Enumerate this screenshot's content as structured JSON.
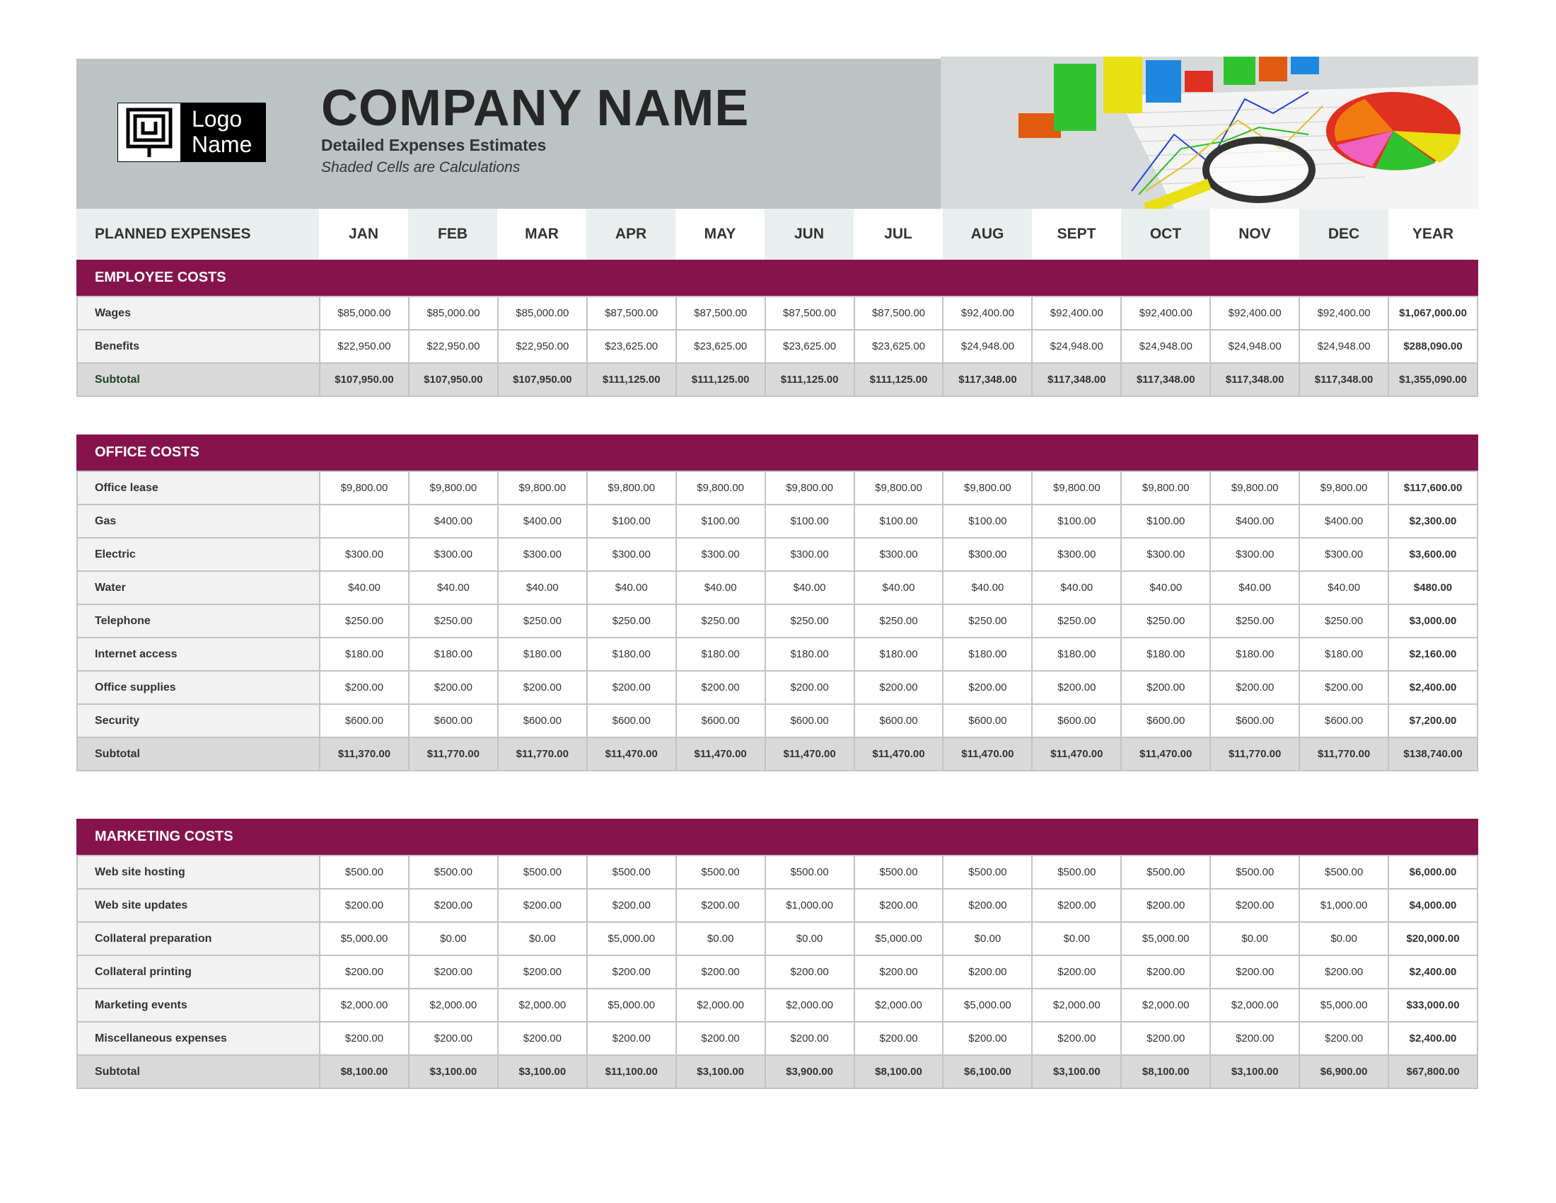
{
  "header": {
    "logo_text": "Logo Name",
    "company_name": "COMPANY NAME",
    "subtitle": "Detailed Expenses Estimates",
    "note": "Shaded Cells are Calculations"
  },
  "columns": {
    "label": "PLANNED EXPENSES",
    "months": [
      "JAN",
      "FEB",
      "MAR",
      "APR",
      "MAY",
      "JUN",
      "JUL",
      "AUG",
      "SEPT",
      "OCT",
      "NOV",
      "DEC",
      "YEAR"
    ]
  },
  "colors": {
    "section_header": "#87134d",
    "banner": "#bcc3c4",
    "subtotal": "#d9d9d9"
  },
  "sections": [
    {
      "title": "EMPLOYEE COSTS",
      "rows": [
        {
          "label": "Wages",
          "values": [
            "$85,000.00",
            "$85,000.00",
            "$85,000.00",
            "$87,500.00",
            "$87,500.00",
            "$87,500.00",
            "$87,500.00",
            "$92,400.00",
            "$92,400.00",
            "$92,400.00",
            "$92,400.00",
            "$92,400.00",
            "$1,067,000.00"
          ]
        },
        {
          "label": "Benefits",
          "values": [
            "$22,950.00",
            "$22,950.00",
            "$22,950.00",
            "$23,625.00",
            "$23,625.00",
            "$23,625.00",
            "$23,625.00",
            "$24,948.00",
            "$24,948.00",
            "$24,948.00",
            "$24,948.00",
            "$24,948.00",
            "$288,090.00"
          ]
        }
      ],
      "subtotal": {
        "label": "Subtotal",
        "values": [
          "$107,950.00",
          "$107,950.00",
          "$107,950.00",
          "$111,125.00",
          "$111,125.00",
          "$111,125.00",
          "$111,125.00",
          "$117,348.00",
          "$117,348.00",
          "$117,348.00",
          "$117,348.00",
          "$117,348.00",
          "$1,355,090.00"
        ]
      }
    },
    {
      "title": "OFFICE COSTS",
      "rows": [
        {
          "label": "Office lease",
          "values": [
            "$9,800.00",
            "$9,800.00",
            "$9,800.00",
            "$9,800.00",
            "$9,800.00",
            "$9,800.00",
            "$9,800.00",
            "$9,800.00",
            "$9,800.00",
            "$9,800.00",
            "$9,800.00",
            "$9,800.00",
            "$117,600.00"
          ]
        },
        {
          "label": "Gas",
          "values": [
            "",
            "$400.00",
            "$400.00",
            "$100.00",
            "$100.00",
            "$100.00",
            "$100.00",
            "$100.00",
            "$100.00",
            "$100.00",
            "$400.00",
            "$400.00",
            "$2,300.00"
          ]
        },
        {
          "label": "Electric",
          "values": [
            "$300.00",
            "$300.00",
            "$300.00",
            "$300.00",
            "$300.00",
            "$300.00",
            "$300.00",
            "$300.00",
            "$300.00",
            "$300.00",
            "$300.00",
            "$300.00",
            "$3,600.00"
          ]
        },
        {
          "label": "Water",
          "values": [
            "$40.00",
            "$40.00",
            "$40.00",
            "$40.00",
            "$40.00",
            "$40.00",
            "$40.00",
            "$40.00",
            "$40.00",
            "$40.00",
            "$40.00",
            "$40.00",
            "$480.00"
          ]
        },
        {
          "label": "Telephone",
          "values": [
            "$250.00",
            "$250.00",
            "$250.00",
            "$250.00",
            "$250.00",
            "$250.00",
            "$250.00",
            "$250.00",
            "$250.00",
            "$250.00",
            "$250.00",
            "$250.00",
            "$3,000.00"
          ]
        },
        {
          "label": "Internet access",
          "values": [
            "$180.00",
            "$180.00",
            "$180.00",
            "$180.00",
            "$180.00",
            "$180.00",
            "$180.00",
            "$180.00",
            "$180.00",
            "$180.00",
            "$180.00",
            "$180.00",
            "$2,160.00"
          ]
        },
        {
          "label": "Office supplies",
          "values": [
            "$200.00",
            "$200.00",
            "$200.00",
            "$200.00",
            "$200.00",
            "$200.00",
            "$200.00",
            "$200.00",
            "$200.00",
            "$200.00",
            "$200.00",
            "$200.00",
            "$2,400.00"
          ]
        },
        {
          "label": "Security",
          "values": [
            "$600.00",
            "$600.00",
            "$600.00",
            "$600.00",
            "$600.00",
            "$600.00",
            "$600.00",
            "$600.00",
            "$600.00",
            "$600.00",
            "$600.00",
            "$600.00",
            "$7,200.00"
          ]
        }
      ],
      "subtotal": {
        "label": "Subtotal",
        "values": [
          "$11,370.00",
          "$11,770.00",
          "$11,770.00",
          "$11,470.00",
          "$11,470.00",
          "$11,470.00",
          "$11,470.00",
          "$11,470.00",
          "$11,470.00",
          "$11,470.00",
          "$11,770.00",
          "$11,770.00",
          "$138,740.00"
        ]
      }
    },
    {
      "title": "MARKETING COSTS",
      "rows": [
        {
          "label": "Web site hosting",
          "values": [
            "$500.00",
            "$500.00",
            "$500.00",
            "$500.00",
            "$500.00",
            "$500.00",
            "$500.00",
            "$500.00",
            "$500.00",
            "$500.00",
            "$500.00",
            "$500.00",
            "$6,000.00"
          ]
        },
        {
          "label": "Web site updates",
          "values": [
            "$200.00",
            "$200.00",
            "$200.00",
            "$200.00",
            "$200.00",
            "$1,000.00",
            "$200.00",
            "$200.00",
            "$200.00",
            "$200.00",
            "$200.00",
            "$1,000.00",
            "$4,000.00"
          ]
        },
        {
          "label": "Collateral preparation",
          "values": [
            "$5,000.00",
            "$0.00",
            "$0.00",
            "$5,000.00",
            "$0.00",
            "$0.00",
            "$5,000.00",
            "$0.00",
            "$0.00",
            "$5,000.00",
            "$0.00",
            "$0.00",
            "$20,000.00"
          ]
        },
        {
          "label": "Collateral printing",
          "values": [
            "$200.00",
            "$200.00",
            "$200.00",
            "$200.00",
            "$200.00",
            "$200.00",
            "$200.00",
            "$200.00",
            "$200.00",
            "$200.00",
            "$200.00",
            "$200.00",
            "$2,400.00"
          ]
        },
        {
          "label": "Marketing events",
          "values": [
            "$2,000.00",
            "$2,000.00",
            "$2,000.00",
            "$5,000.00",
            "$2,000.00",
            "$2,000.00",
            "$2,000.00",
            "$5,000.00",
            "$2,000.00",
            "$2,000.00",
            "$2,000.00",
            "$5,000.00",
            "$33,000.00"
          ]
        },
        {
          "label": "Miscellaneous expenses",
          "values": [
            "$200.00",
            "$200.00",
            "$200.00",
            "$200.00",
            "$200.00",
            "$200.00",
            "$200.00",
            "$200.00",
            "$200.00",
            "$200.00",
            "$200.00",
            "$200.00",
            "$2,400.00"
          ]
        }
      ],
      "subtotal": {
        "label": "Subtotal",
        "values": [
          "$8,100.00",
          "$3,100.00",
          "$3,100.00",
          "$11,100.00",
          "$3,100.00",
          "$3,900.00",
          "$8,100.00",
          "$6,100.00",
          "$3,100.00",
          "$8,100.00",
          "$3,100.00",
          "$6,900.00",
          "$67,800.00"
        ]
      }
    }
  ]
}
